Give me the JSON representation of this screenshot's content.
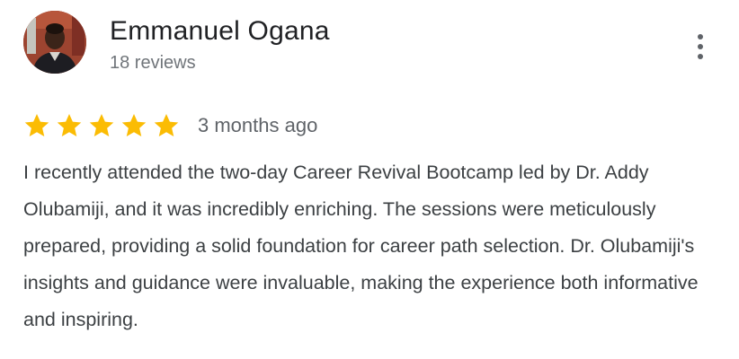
{
  "review": {
    "author": {
      "name": "Emmanuel Ogana",
      "reviews": "18 reviews"
    },
    "rating": {
      "stars": 5,
      "max_stars": 5,
      "time_ago": "3 months ago"
    },
    "text": "I recently attended the two-day Career Revival Bootcamp led by Dr. Addy Olubamiji, and it was incredibly enriching. The sessions were meticulously prepared, providing a solid foundation for career path selection. Dr. Olubamiji's insights and guidance were invaluable, making the experience both informative and inspiring."
  },
  "icons": {
    "star": "star-icon",
    "more": "more-vert-icon"
  },
  "colors": {
    "star": "#FBBC04",
    "name": "#202124",
    "secondary": "#70757a",
    "body": "#3c4043",
    "menu_dots": "#5f6368"
  }
}
